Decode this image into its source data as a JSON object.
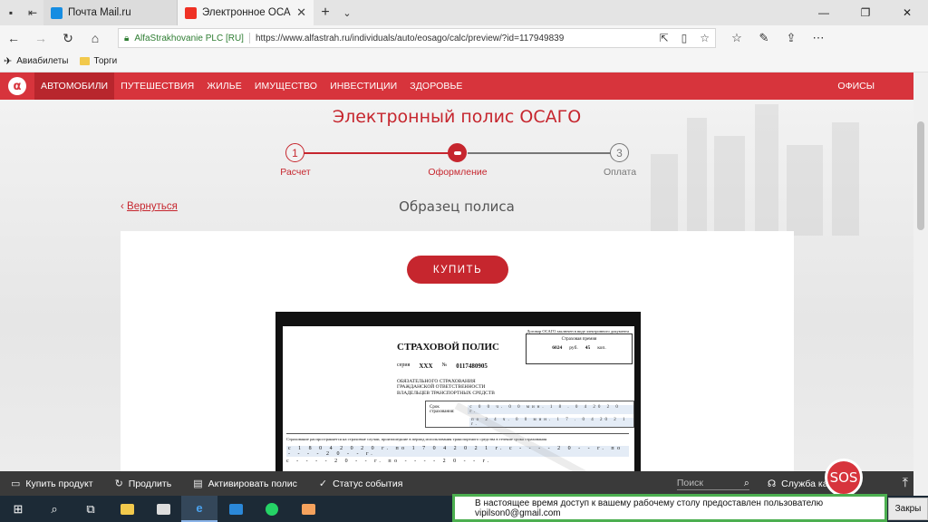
{
  "browser": {
    "tabs": [
      {
        "label": "Почта Mail.ru",
        "icon": "mail-ru-icon"
      },
      {
        "label": "Электронное ОСАГО",
        "icon": "alfa-icon"
      }
    ],
    "address": {
      "cert": "AlfaStrakhovanie PLC [RU]",
      "url": "https://www.alfastrah.ru/individuals/auto/eosago/calc/preview/?id=117949839"
    },
    "bookmarks": [
      "Авиабилеты",
      "Торги"
    ]
  },
  "site": {
    "nav": [
      "АВТОМОБИЛИ",
      "ПУТЕШЕСТВИЯ",
      "ЖИЛЬЕ",
      "ИМУЩЕСТВО",
      "ИНВЕСТИЦИИ",
      "ЗДОРОВЬЕ"
    ],
    "offices": "ОФИСЫ",
    "logo": "α"
  },
  "page": {
    "title": "Электронный полис ОСАГО",
    "steps": [
      {
        "num": "1",
        "label": "Расчет"
      },
      {
        "num": "",
        "label": "Оформление"
      },
      {
        "num": "3",
        "label": "Оплата"
      }
    ],
    "back": "Вернуться",
    "back_arrow": "‹",
    "sample_title": "Образец полиса",
    "buy": "КУПИТЬ"
  },
  "policy": {
    "top_note": "Договор ОСАГО заключен в виде электронного документа",
    "title": "СТРАХОВОЙ ПОЛИС",
    "series_label": "серия",
    "series": "XXX",
    "number_label": "№",
    "number": "0117480905",
    "premium_label": "Страховая премия",
    "premium_rub": "6024",
    "premium_rub_unit": "руб.",
    "premium_kop": "45",
    "premium_kop_unit": "коп.",
    "insure_lines": [
      "ОБЯЗАТЕЛЬНОГО СТРАХОВАНИЯ",
      "ГРАЖДАНСКОЙ ОТВЕТСТВЕННОСТИ",
      "ВЛАДЕЛЬЦЕВ ТРАНСПОРТНЫХ СРЕДСТВ"
    ],
    "term_label": "Срок страхования:",
    "term_from": "с 0 0 ч. 0 0 мин. 1 8 . 0 4 20 2 0 г.",
    "term_to": "по 2 4 ч. 0 0 мин. 1 7 . 0 4 20 2 1 г.",
    "note": "Страхование распространяется на страховые случаи, произошедшие в период использования транспортного средства в течение срока страхования",
    "row2": "с 1 8 0 4 2 0 2 0 г. по 1 7 0 4 2 0 2 1 г. с - - - - 2 0 - - г. по - - - - 2 0 - - г.",
    "row3": "с - - - - 2 0 - - г. по - - - - 2 0 - - г."
  },
  "bottom_bar": {
    "items": [
      "Купить продукт",
      "Продлить",
      "Активировать полис",
      "Статус события"
    ],
    "search_placeholder": "Поиск",
    "quality": "Служба качества",
    "sos": "SOS"
  },
  "notification": {
    "text": "В настоящее время доступ к вашему рабочему столу предоставлен пользователю vipilson0@gmail.com",
    "close": "Закры"
  },
  "colors": {
    "brand": "#d7343c",
    "accent": "#c6262e",
    "notify_border": "#4caf50"
  }
}
